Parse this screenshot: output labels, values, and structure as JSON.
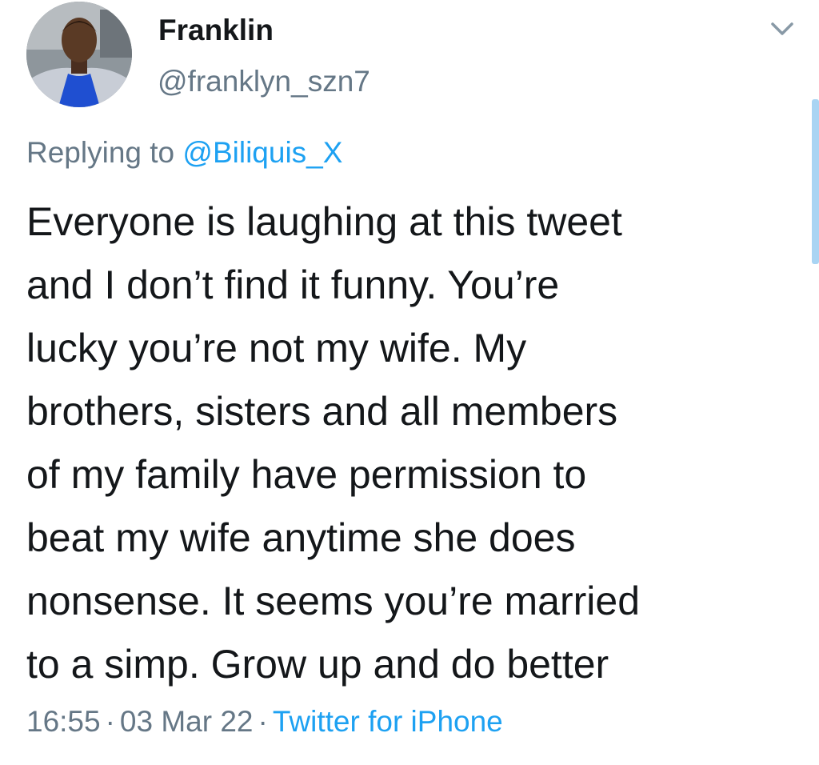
{
  "author": {
    "name": "Franklin",
    "handle": "@franklyn_szn7"
  },
  "reply": {
    "prefix": "Replying to ",
    "mention": "@Biliquis_X"
  },
  "tweet": {
    "lines": [
      "Everyone is laughing at this tweet",
      "and I don’t find it funny. You’re",
      "lucky you’re not my wife. My",
      "brothers, sisters and all members",
      "of my family have permission to",
      "beat my wife anytime she does",
      "nonsense. It seems you’re married",
      "to a simp. Grow up and do better"
    ]
  },
  "meta": {
    "time": "16:55",
    "separator": "·",
    "date": "03 Mar 22",
    "source": "Twitter for iPhone"
  },
  "icons": {
    "menu": "chevron-down-icon"
  },
  "colors": {
    "text": "#14171a",
    "secondary": "#657786",
    "accent": "#1da1f2",
    "scrollbar": "#a9d4f3"
  }
}
